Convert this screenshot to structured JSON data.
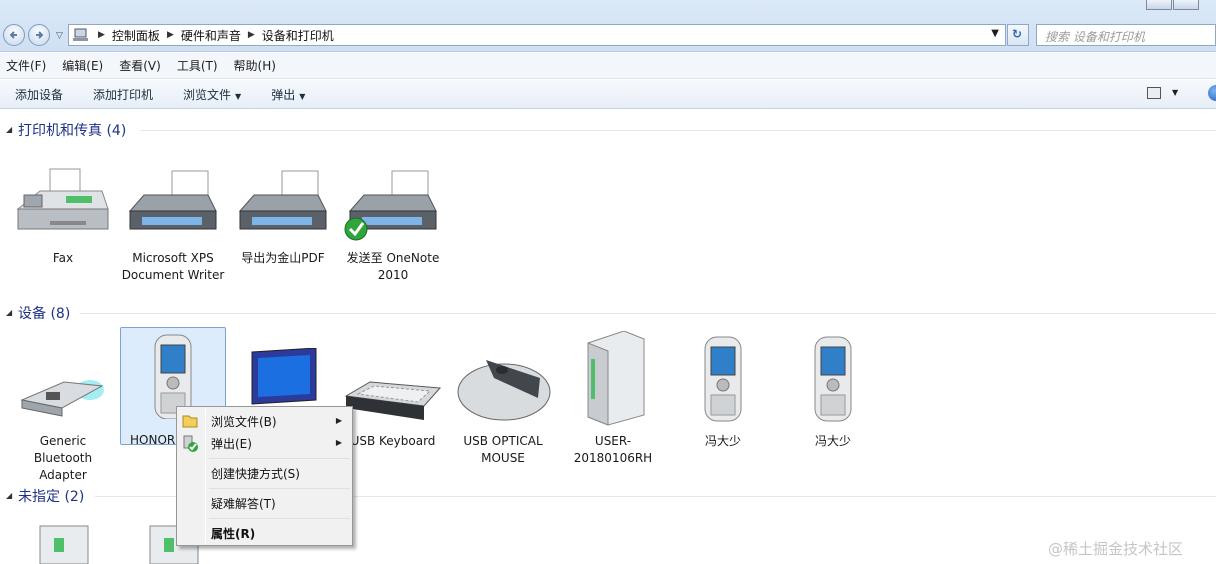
{
  "address": {
    "breadcrumbs": [
      "控制面板",
      "硬件和声音",
      "设备和打印机"
    ],
    "search_placeholder": "搜索 设备和打印机"
  },
  "menu": [
    "文件(F)",
    "编辑(E)",
    "查看(V)",
    "工具(T)",
    "帮助(H)"
  ],
  "toolbar": {
    "add_device": "添加设备",
    "add_printer": "添加打印机",
    "browse_files": "浏览文件",
    "eject": "弹出"
  },
  "groups": {
    "printers": {
      "title": "打印机和传真 (4)"
    },
    "devices": {
      "title": "设备 (8)"
    },
    "unspecified": {
      "title": "未指定 (2)"
    }
  },
  "printers": [
    {
      "label": "Fax",
      "icon": "fax-icon"
    },
    {
      "label": "Microsoft XPS Document Writer",
      "icon": "printer-icon"
    },
    {
      "label": "导出为金山PDF",
      "icon": "printer-icon"
    },
    {
      "label": "发送至 OneNote 2010",
      "icon": "printer-default-icon"
    }
  ],
  "devices": [
    {
      "label": "Generic Bluetooth Adapter",
      "icon": "usb-bluetooth-icon"
    },
    {
      "label": "HONOR",
      "icon": "phone-icon"
    },
    {
      "label": "",
      "icon": "monitor-icon"
    },
    {
      "label": "USB Keyboard",
      "icon": "keyboard-icon"
    },
    {
      "label": "USB OPTICAL MOUSE",
      "icon": "mouse-icon"
    },
    {
      "label": "USER-20180106RH",
      "icon": "computer-icon"
    },
    {
      "label": "冯大少",
      "icon": "phone-icon"
    },
    {
      "label": "冯大少",
      "icon": "phone-icon"
    }
  ],
  "context_menu": {
    "browse": "浏览文件(B)",
    "eject": "弹出(E)",
    "shortcut": "创建快捷方式(S)",
    "troubleshoot": "疑难解答(T)",
    "properties": "属性(R)"
  },
  "watermark": "@稀土掘金技术社区",
  "colors": {
    "group_title": "#1e3287",
    "selection": "#dcecfc",
    "accent": "#1b5fbf"
  }
}
